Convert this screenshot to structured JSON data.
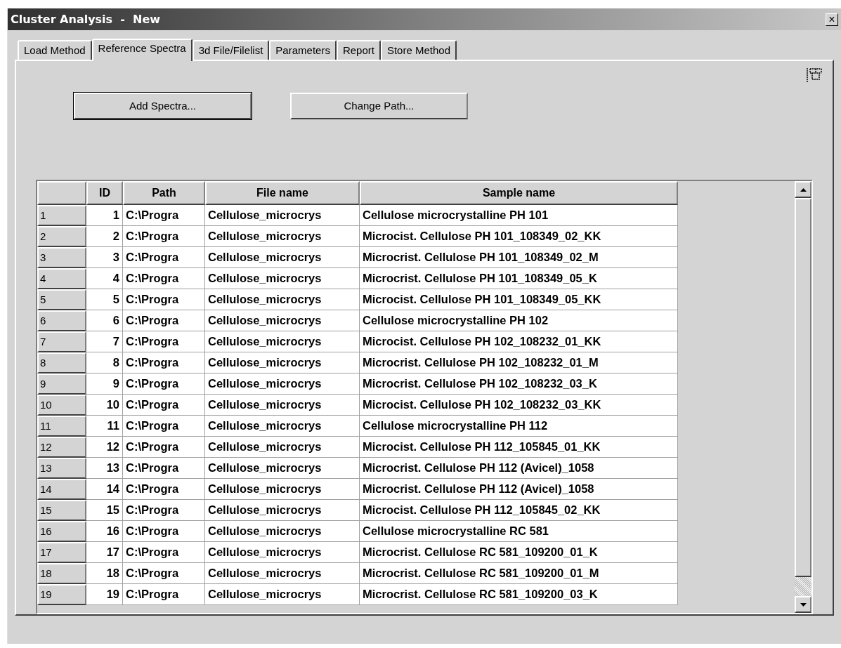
{
  "window": {
    "title": "Cluster Analysis  -  New",
    "close": "×"
  },
  "tabs": [
    {
      "label": "Load Method",
      "selected": false
    },
    {
      "label": "Reference Spectra",
      "selected": true
    },
    {
      "label": "3d File/Filelist",
      "selected": false
    },
    {
      "label": "Parameters",
      "selected": false
    },
    {
      "label": "Report",
      "selected": false
    },
    {
      "label": "Store Method",
      "selected": false
    }
  ],
  "buttons": [
    {
      "label": "Add Spectra...",
      "default": true
    },
    {
      "label": "Change Path...",
      "default": false
    }
  ],
  "table": {
    "columns": [
      "ID",
      "Path",
      "File name",
      "Sample name"
    ],
    "rows": [
      {
        "header": "1",
        "cells": [
          "1",
          "C:\\Progra",
          "Cellulose_microcrys",
          "Cellulose microcrystalline PH 101"
        ]
      },
      {
        "header": "2",
        "cells": [
          "2",
          "C:\\Progra",
          "Cellulose_microcrys",
          "Microcist. Cellulose PH 101_108349_02_KK"
        ]
      },
      {
        "header": "3",
        "cells": [
          "3",
          "C:\\Progra",
          "Cellulose_microcrys",
          "Microcrist. Cellulose PH 101_108349_02_M"
        ]
      },
      {
        "header": "4",
        "cells": [
          "4",
          "C:\\Progra",
          "Cellulose_microcrys",
          "Microcrist. Cellulose PH 101_108349_05_K"
        ]
      },
      {
        "header": "5",
        "cells": [
          "5",
          "C:\\Progra",
          "Cellulose_microcrys",
          "Microcist. Cellulose PH 101_108349_05_KK"
        ]
      },
      {
        "header": "6",
        "cells": [
          "6",
          "C:\\Progra",
          "Cellulose_microcrys",
          "Cellulose microcrystalline PH 102"
        ]
      },
      {
        "header": "7",
        "cells": [
          "7",
          "C:\\Progra",
          "Cellulose_microcrys",
          "Microcist. Cellulose PH 102_108232_01_KK"
        ]
      },
      {
        "header": "8",
        "cells": [
          "8",
          "C:\\Progra",
          "Cellulose_microcrys",
          "Microcrist. Cellulose PH 102_108232_01_M"
        ]
      },
      {
        "header": "9",
        "cells": [
          "9",
          "C:\\Progra",
          "Cellulose_microcrys",
          "Microcrist. Cellulose PH 102_108232_03_K"
        ]
      },
      {
        "header": "10",
        "cells": [
          "10",
          "C:\\Progra",
          "Cellulose_microcrys",
          "Microcist. Cellulose PH 102_108232_03_KK"
        ]
      },
      {
        "header": "11",
        "cells": [
          "11",
          "C:\\Progra",
          "Cellulose_microcrys",
          "Cellulose microcrystalline PH 112"
        ]
      },
      {
        "header": "12",
        "cells": [
          "12",
          "C:\\Progra",
          "Cellulose_microcrys",
          "Microcist. Cellulose PH 112_105845_01_KK"
        ]
      },
      {
        "header": "13",
        "cells": [
          "13",
          "C:\\Progra",
          "Cellulose_microcrys",
          "Microcrist. Cellulose PH 112 (Avicel)_1058"
        ]
      },
      {
        "header": "14",
        "cells": [
          "14",
          "C:\\Progra",
          "Cellulose_microcrys",
          "Microcrist. Cellulose PH 112 (Avicel)_1058"
        ]
      },
      {
        "header": "15",
        "cells": [
          "15",
          "C:\\Progra",
          "Cellulose_microcrys",
          "Microcist. Cellulose PH 112_105845_02_KK"
        ]
      },
      {
        "header": "16",
        "cells": [
          "16",
          "C:\\Progra",
          "Cellulose_microcrys",
          "Cellulose microcrystalline RC 581"
        ]
      },
      {
        "header": "17",
        "cells": [
          "17",
          "C:\\Progra",
          "Cellulose_microcrys",
          "Microcrist. Cellulose RC 581_109200_01_K"
        ]
      },
      {
        "header": "18",
        "cells": [
          "18",
          "C:\\Progra",
          "Cellulose_microcrys",
          "Microcrist. Cellulose RC 581_109200_01_M"
        ]
      },
      {
        "header": "19",
        "cells": [
          "19",
          "C:\\Progra",
          "Cellulose_microcrys",
          "Microcrist. Cellulose RC 581_109200_03_K"
        ]
      }
    ]
  }
}
